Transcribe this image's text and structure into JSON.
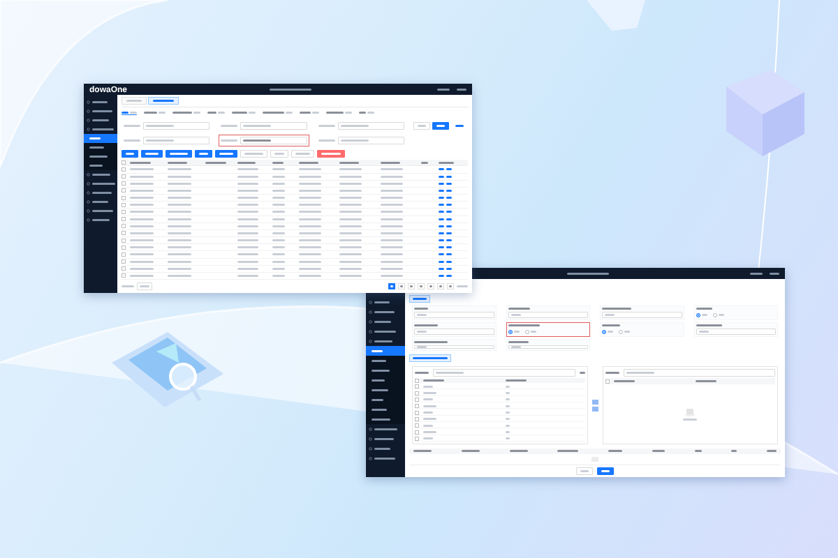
{
  "window_1": {
    "logo": "dowaOne",
    "sidebar": [
      {
        "selected": false
      },
      {
        "selected": false
      },
      {
        "selected": false
      },
      {
        "selected": false,
        "children": [
          {
            "selected": true
          },
          {
            "selected": false
          },
          {
            "selected": false
          },
          {
            "selected": false
          }
        ]
      },
      {
        "selected": false
      },
      {
        "selected": false
      },
      {
        "selected": false
      },
      {
        "selected": false
      },
      {
        "selected": false
      },
      {
        "selected": false
      }
    ],
    "tabs": [
      {
        "selected": false
      },
      {
        "selected": true
      }
    ],
    "status_filters": [
      {
        "selected": true
      },
      {
        "selected": false
      },
      {
        "selected": false
      },
      {
        "selected": false
      },
      {
        "selected": false
      },
      {
        "selected": false
      },
      {
        "selected": false
      },
      {
        "selected": false
      },
      {
        "selected": false
      }
    ],
    "filter_fields": [
      {
        "highlighted": false
      },
      {
        "highlighted": false
      },
      {
        "highlighted": false
      },
      {
        "highlighted": false
      },
      {
        "highlighted": true
      },
      {
        "highlighted": false
      }
    ],
    "search_buttons": [
      {
        "kind": "plain"
      },
      {
        "kind": "primary"
      },
      {
        "kind": "link"
      }
    ],
    "actions": [
      {
        "kind": "primary"
      },
      {
        "kind": "primary"
      },
      {
        "kind": "primary"
      },
      {
        "kind": "primary"
      },
      {
        "kind": "primary"
      },
      {
        "kind": "plain"
      },
      {
        "kind": "plain"
      },
      {
        "kind": "plain"
      },
      {
        "kind": "danger"
      }
    ],
    "table": {
      "all_checked": false,
      "rows": [
        {
          "checked": false
        },
        {
          "checked": false
        },
        {
          "checked": false
        },
        {
          "checked": false
        },
        {
          "checked": false
        },
        {
          "checked": false
        },
        {
          "checked": false
        },
        {
          "checked": false
        },
        {
          "checked": false
        },
        {
          "checked": false
        },
        {
          "checked": false
        },
        {
          "checked": false
        },
        {
          "checked": false
        },
        {
          "checked": false
        },
        {
          "checked": false
        },
        {
          "checked": false
        }
      ]
    },
    "pagination": {
      "pages": [
        {
          "selected": true
        },
        {
          "selected": false
        },
        {
          "selected": false
        },
        {
          "selected": false
        },
        {
          "selected": false
        },
        {
          "selected": false
        },
        {
          "selected": false
        }
      ]
    }
  },
  "window_2": {
    "sidebar": [
      {
        "selected": false
      },
      {
        "selected": false
      },
      {
        "selected": false
      },
      {
        "selected": false
      },
      {
        "selected": false,
        "children": [
          {
            "selected": true
          },
          {
            "selected": false
          },
          {
            "selected": false
          },
          {
            "selected": false
          },
          {
            "selected": false
          },
          {
            "selected": false
          },
          {
            "selected": false
          },
          {
            "selected": false
          }
        ]
      },
      {
        "selected": false
      },
      {
        "selected": false
      },
      {
        "selected": false
      },
      {
        "selected": false
      }
    ],
    "fields": [
      {
        "kind": "input",
        "highlighted": false
      },
      {
        "kind": "input",
        "highlighted": false
      },
      {
        "kind": "input",
        "highlighted": false
      },
      {
        "kind": "radio",
        "highlighted": false,
        "options": [
          {
            "selected": true
          },
          {
            "selected": false
          }
        ]
      },
      {
        "kind": "input",
        "highlighted": false
      },
      {
        "kind": "radio",
        "highlighted": true,
        "options": [
          {
            "selected": true
          },
          {
            "selected": false
          }
        ]
      },
      {
        "kind": "radio",
        "highlighted": false,
        "options": [
          {
            "selected": true
          },
          {
            "selected": false
          }
        ]
      },
      {
        "kind": "input",
        "highlighted": false
      },
      {
        "kind": "input",
        "highlighted": false
      },
      {
        "kind": "input",
        "highlighted": false
      }
    ],
    "unconfigured": {
      "all_checked": false,
      "rows": [
        {
          "checked": false
        },
        {
          "checked": false
        },
        {
          "checked": false
        },
        {
          "checked": false
        },
        {
          "checked": false
        },
        {
          "checked": false
        },
        {
          "checked": false
        },
        {
          "checked": false
        },
        {
          "checked": false
        }
      ]
    },
    "configured": {
      "all_checked": false
    },
    "buttons": [
      {
        "kind": "plain"
      },
      {
        "kind": "primary"
      }
    ]
  }
}
